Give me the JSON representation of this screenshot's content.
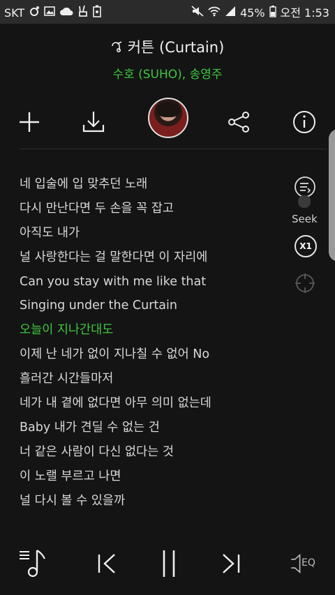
{
  "status_bar": {
    "carrier": "SKT",
    "battery": "45%",
    "time": "오전 1:53"
  },
  "song": {
    "title": "커튼 (Curtain)",
    "artist": "수호 (SUHO), 송영주"
  },
  "lyrics": [
    "네 입술에 입 맞추던 노래",
    "다시 만난다면 두 손을 꼭 잡고",
    "아직도 내가",
    "널 사랑한다는 걸 말한다면 이 자리에",
    "Can you stay with me like that",
    "Singing under the Curtain",
    "오늘이 지나간대도",
    "이제 난 네가 없이 지나칠 수 없어 No",
    "흘러간 시간들마저",
    "네가 내 곁에 없다면 아무 의미 없는데",
    "Baby 내가 견딜 수 없는 건",
    "너 같은 사람이 다신 없다는 것",
    "이 노랠 부르고 나면",
    "널 다시 볼 수 있을까"
  ],
  "active_lyric_index": 6,
  "side_controls": {
    "seek_label": "Seek",
    "speed": "X1"
  },
  "bottom": {
    "eq_label": "EQ"
  },
  "colors": {
    "accent": "#3ec73e",
    "background": "#141414",
    "status_bar": "#2b2b2b"
  },
  "icons": [
    "add-icon",
    "download-icon",
    "share-icon",
    "info-icon",
    "lyrics-scroll-icon",
    "target-icon",
    "playlist-icon",
    "previous-icon",
    "pause-icon",
    "next-icon",
    "equalizer-icon"
  ]
}
